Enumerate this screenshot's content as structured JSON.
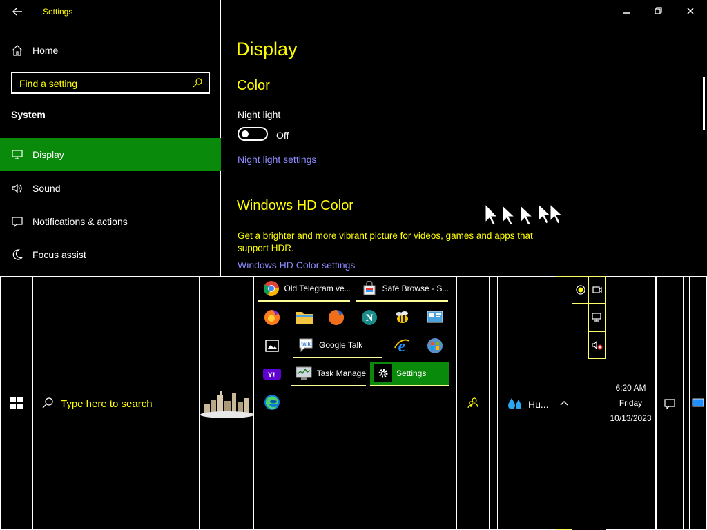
{
  "settings": {
    "app_title": "Settings",
    "nav": {
      "home": "Home",
      "search_placeholder": "Find a setting",
      "section": "System",
      "items": [
        {
          "label": "Display",
          "icon": "monitor-icon",
          "selected": true
        },
        {
          "label": "Sound",
          "icon": "speaker-icon"
        },
        {
          "label": "Notifications & actions",
          "icon": "message-icon"
        },
        {
          "label": "Focus assist",
          "icon": "moon-icon"
        }
      ]
    },
    "main": {
      "page_title": "Display",
      "color_heading": "Color",
      "night_light_label": "Night light",
      "night_light_state": "Off",
      "night_light_link": "Night light settings",
      "hd_heading": "Windows HD Color",
      "hd_description": "Get a brighter and more vibrant picture for videos, games and apps that support HDR.",
      "hd_link": "Windows HD Color settings"
    }
  },
  "taskbar": {
    "search_placeholder": "Type here to search",
    "apps": {
      "chrome_window": "Old Telegram ve...",
      "safe_browse_window": "Safe Browse - S...",
      "google_talk": "Google Talk",
      "task_manager": "Task Manager",
      "settings": "Settings"
    },
    "weather": "Hu...",
    "clock": {
      "time": "6:20 AM",
      "day": "Friday",
      "date": "10/13/2023"
    }
  },
  "colors": {
    "accent_green": "#0a8a0a",
    "heading_yellow": "#ffff00",
    "link_purple": "#8c8cff"
  }
}
